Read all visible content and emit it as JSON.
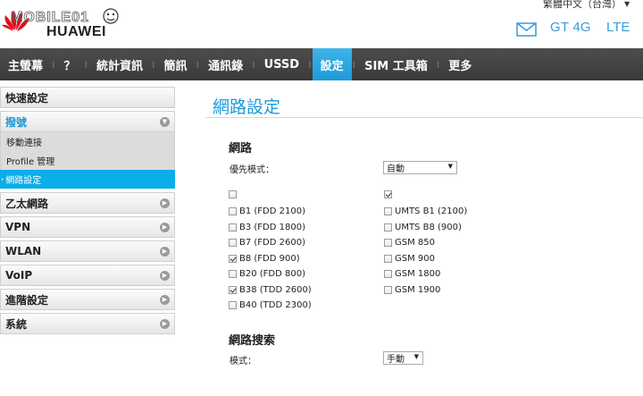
{
  "header": {
    "logo_text": "HUAWEI",
    "watermark_text": "MOBILE01",
    "language": "繁體中文（台灣）",
    "network_type": "GT 4G",
    "network_mode": "LTE"
  },
  "nav": {
    "items": [
      {
        "label": "主螢幕",
        "active": false
      },
      {
        "label": "？",
        "active": false
      },
      {
        "label": "統計資訊",
        "active": false
      },
      {
        "label": "簡訊",
        "active": false
      },
      {
        "label": "通訊錄",
        "active": false
      },
      {
        "label": "USSD",
        "active": false
      },
      {
        "label": "設定",
        "active": true
      },
      {
        "label": "SIM 工具箱",
        "active": false
      },
      {
        "label": "更多",
        "active": false
      }
    ]
  },
  "sidebar": {
    "quick_setup": "快速設定",
    "dialup": "撥號",
    "dialup_sub": [
      "移動連接",
      "Profile 管理",
      "網路設定"
    ],
    "others": [
      "乙太網路",
      "VPN",
      "WLAN",
      "VoIP",
      "進階設定",
      "系統"
    ]
  },
  "content": {
    "page_title": "網路設定",
    "network_section": "網路",
    "preferred_mode_label": "優先模式：",
    "preferred_mode_value": "自動",
    "lte_bands": [
      {
        "label": "",
        "checked": false
      },
      {
        "label": "B1 (FDD 2100)",
        "checked": false
      },
      {
        "label": "B3 (FDD 1800)",
        "checked": false
      },
      {
        "label": "B7 (FDD 2600)",
        "checked": false
      },
      {
        "label": "B8 (FDD 900)",
        "checked": true
      },
      {
        "label": "B20 (FDD 800)",
        "checked": false
      },
      {
        "label": "B38 (TDD 2600)",
        "checked": true
      },
      {
        "label": "B40 (TDD 2300)",
        "checked": false
      }
    ],
    "other_bands": [
      {
        "label": "",
        "checked": true
      },
      {
        "label": "UMTS B1 (2100)",
        "checked": false
      },
      {
        "label": "UMTS B8 (900)",
        "checked": false
      },
      {
        "label": "GSM 850",
        "checked": false
      },
      {
        "label": "GSM 900",
        "checked": false
      },
      {
        "label": "GSM 1800",
        "checked": false
      },
      {
        "label": "GSM 1900",
        "checked": false
      }
    ],
    "search_section": "網路搜索",
    "search_mode_label": "模式：",
    "search_mode_value": "手動"
  },
  "colors": {
    "accent": "#1d9ad8",
    "nav_bg": "#444444",
    "brand_red": "#e0101e"
  },
  "icons": [
    "huawei-logo",
    "mail-icon",
    "chevron-down-icon",
    "chevron-right-icon",
    "checkbox"
  ]
}
